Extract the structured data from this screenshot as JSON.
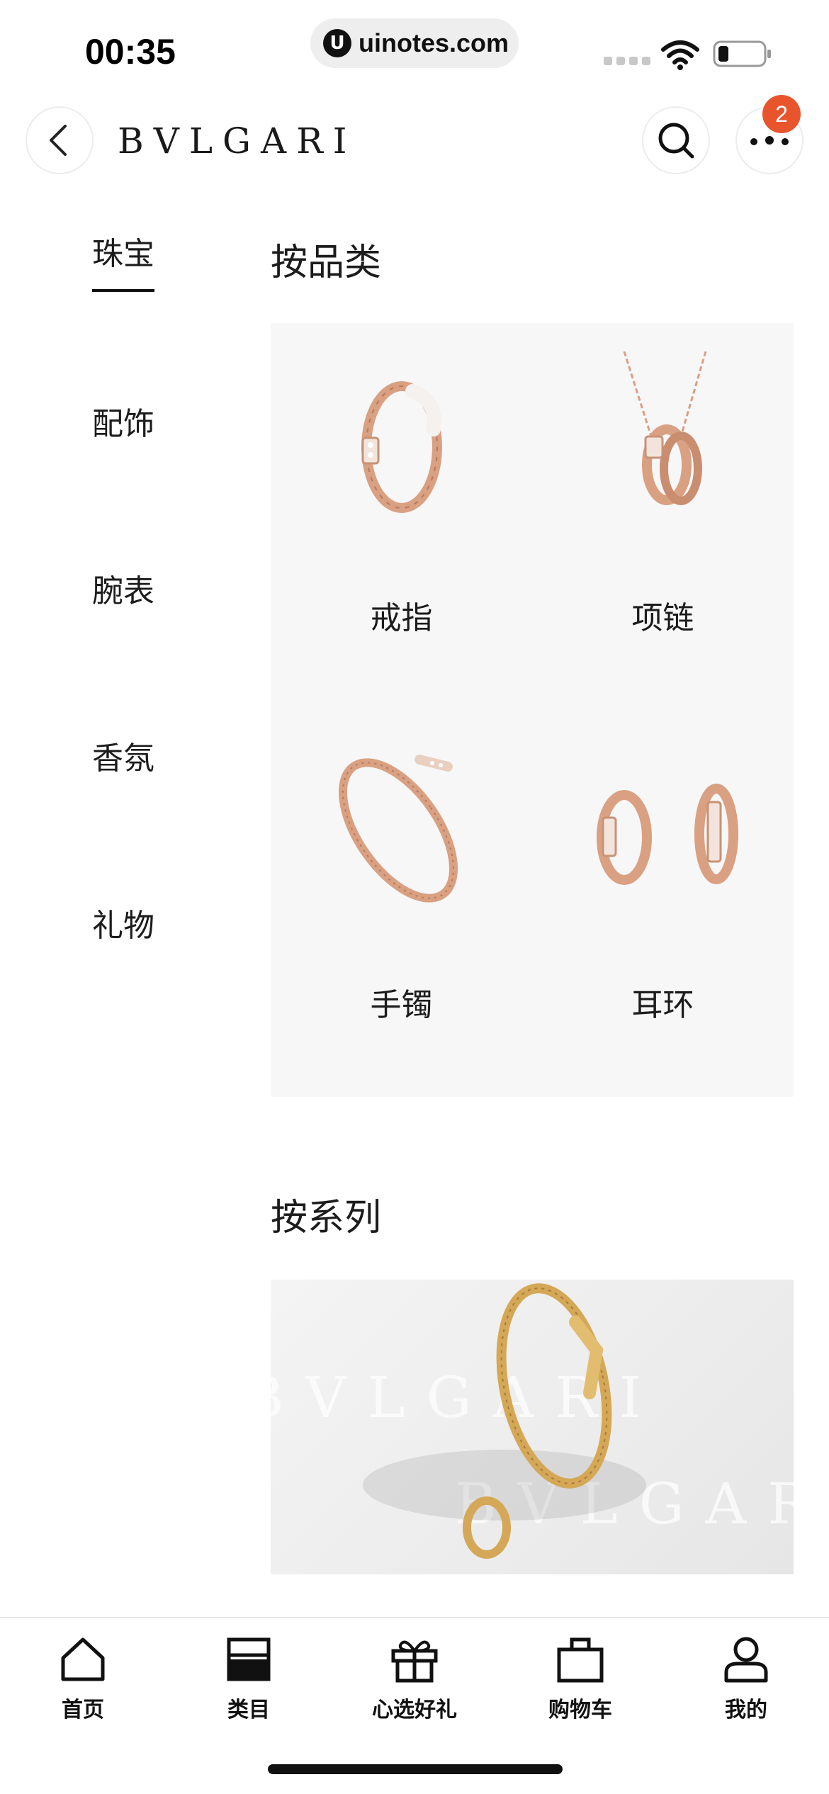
{
  "status_bar": {
    "time": "00:35",
    "watermark_text": "uinotes.com",
    "watermark_logo": "U"
  },
  "header": {
    "brand": "BVLGARI",
    "badge_count": "2",
    "icons": {
      "back": "chevron-left-icon",
      "search": "search-icon",
      "more": "more-dots-icon"
    }
  },
  "side_nav": {
    "items": [
      {
        "label": "珠宝",
        "active": true
      },
      {
        "label": "配饰",
        "active": false
      },
      {
        "label": "腕表",
        "active": false
      },
      {
        "label": "香氛",
        "active": false
      },
      {
        "label": "礼物",
        "active": false
      }
    ]
  },
  "main": {
    "by_category_title": "按品类",
    "categories": [
      {
        "label": "戒指",
        "icon": "ring-image"
      },
      {
        "label": "项链",
        "icon": "necklace-image"
      },
      {
        "label": "手镯",
        "icon": "bracelet-image"
      },
      {
        "label": "耳环",
        "icon": "earrings-image"
      }
    ],
    "by_series_title": "按系列",
    "banner_watermark": "BVLGARI"
  },
  "tab_bar": {
    "tabs": [
      {
        "label": "首页",
        "icon": "home-icon"
      },
      {
        "label": "类目",
        "icon": "category-icon"
      },
      {
        "label": "心选好礼",
        "icon": "gift-icon"
      },
      {
        "label": "购物车",
        "icon": "shopping-bag-icon"
      },
      {
        "label": "我的",
        "icon": "profile-icon"
      }
    ]
  },
  "colors": {
    "badge": "#e8542c",
    "rose_gold": "#d9a082",
    "gold": "#d4a857",
    "panel_bg": "#f7f7f8"
  }
}
